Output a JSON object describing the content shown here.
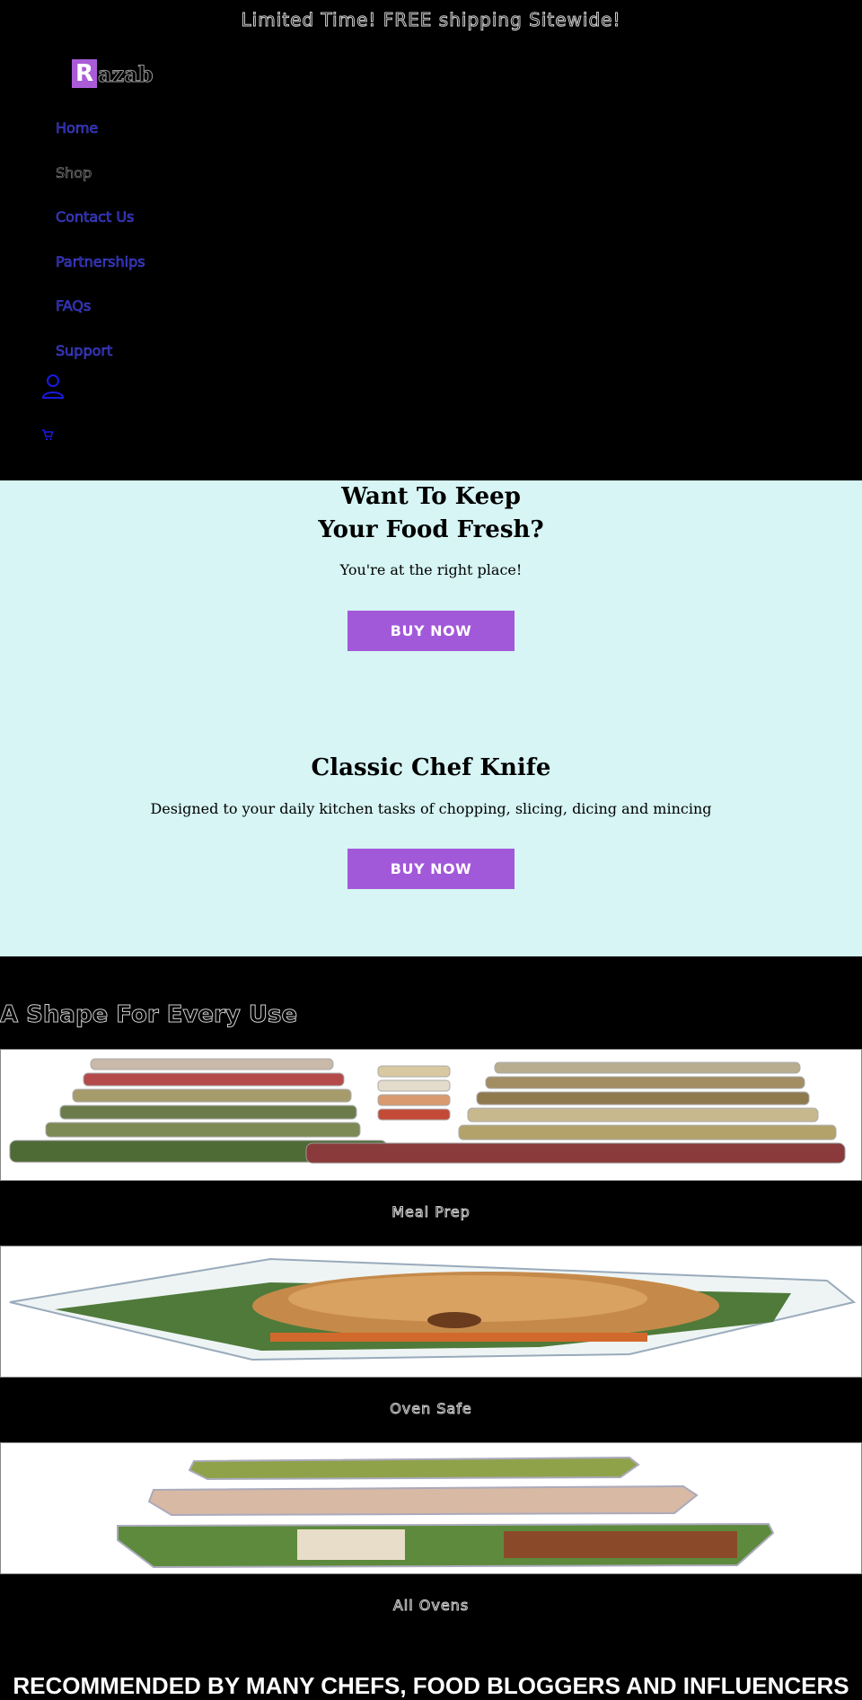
{
  "announcement": "Limited Time! FREE shipping Sitewide!",
  "logo": {
    "initial": "R",
    "rest": "azab"
  },
  "nav": [
    {
      "label": "Home",
      "style": "blue"
    },
    {
      "label": "Shop",
      "style": "grey"
    },
    {
      "label": "Contact Us",
      "style": "blue"
    },
    {
      "label": "Partnerships",
      "style": "blue"
    },
    {
      "label": "FAQs",
      "style": "blue"
    },
    {
      "label": "Support",
      "style": "blue"
    }
  ],
  "icons": {
    "account": "user-icon",
    "cart": "cart-icon"
  },
  "hero": {
    "title_line1": "Want To Keep",
    "title_line2": "Your Food Fresh?",
    "subtitle": "You're at the right place!",
    "button": "BUY NOW"
  },
  "knife": {
    "title": "Classic Chef Knife",
    "subtitle": "Designed to your daily kitchen tasks of chopping, slicing, dicing and mincing",
    "button": "BUY NOW"
  },
  "shapes": {
    "title": "A Shape For Every Use",
    "items": [
      {
        "caption": "Meal Prep"
      },
      {
        "caption": "Oven Safe"
      },
      {
        "caption": "All Ovens"
      }
    ]
  },
  "recommended": "RECOMMENDED BY MANY CHEFS, FOOD BLOGGERS AND INFLUENCERS",
  "colors": {
    "accent": "#a259d9",
    "hero_bg": "#d6f5f4",
    "page_bg": "#000000"
  }
}
